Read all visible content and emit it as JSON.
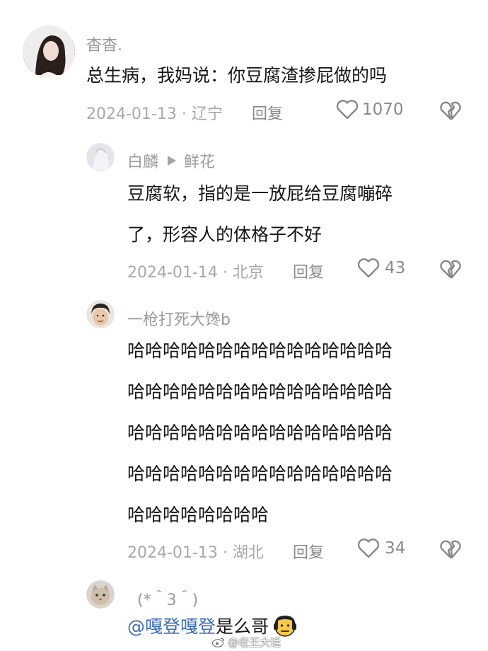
{
  "comments": [
    {
      "username": "杳杳.",
      "text": "总生病，我妈说：你豆腐渣掺屁做的吗",
      "date": "2024-01-13",
      "sep": "·",
      "location": "辽宁",
      "reply_label": "回复",
      "likes": "1070"
    },
    {
      "username": "白麟",
      "reply_to": "鲜花",
      "text_lines": [
        "豆腐软，指的是一放屁给豆腐嘣碎",
        "了，形容人的体格子不好"
      ],
      "date": "2024-01-14",
      "sep": "·",
      "location": "北京",
      "reply_label": "回复",
      "likes": "43"
    },
    {
      "username": "一枪打死大馋b",
      "text_lines": [
        "哈哈哈哈哈哈哈哈哈哈哈哈哈哈哈",
        "哈哈哈哈哈哈哈哈哈哈哈哈哈哈哈",
        "哈哈哈哈哈哈哈哈哈哈哈哈哈哈哈",
        "哈哈哈哈哈哈哈哈哈哈哈哈哈哈哈",
        "哈哈哈哈哈哈哈哈"
      ],
      "date": "2024-01-13",
      "sep": "·",
      "location": "湖北",
      "reply_label": "回复",
      "likes": "34"
    },
    {
      "username": "(*＾3＾)",
      "mention": "@嘎登嘎登",
      "text": " 是么哥",
      "emoji": "sweating-face-emoji"
    }
  ],
  "watermark": "@老王大话",
  "icons": {
    "like": "heart-outline-icon",
    "dislike": "broken-heart-icon",
    "play_arrow": "triangle-right-icon"
  }
}
